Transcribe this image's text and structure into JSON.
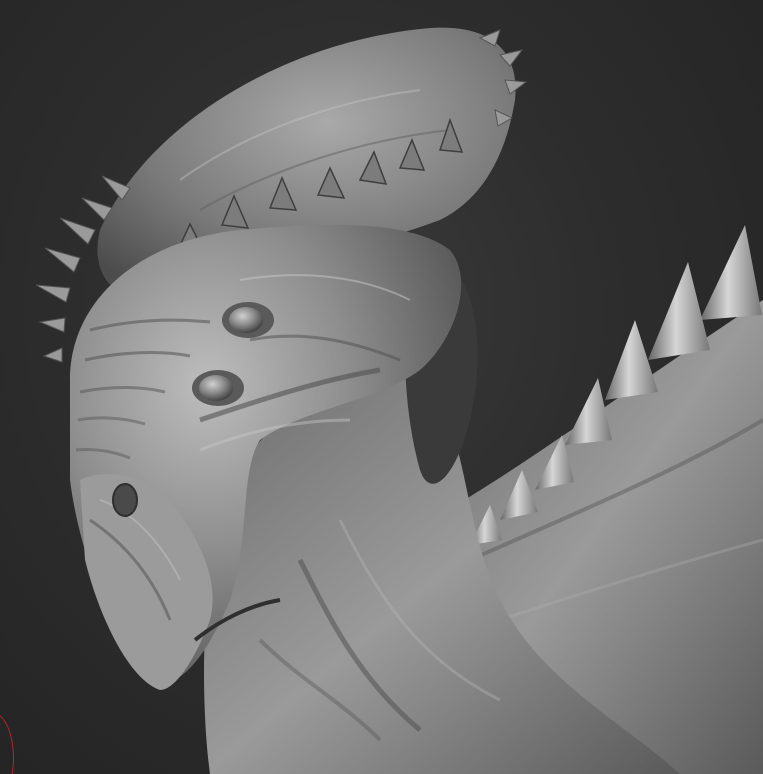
{
  "viewport": {
    "subject": "creature-head-sculpt",
    "background_color": "#2b2b2b",
    "material_color": "#8e8e8e",
    "brush_cursor_color": "#b3262a"
  }
}
